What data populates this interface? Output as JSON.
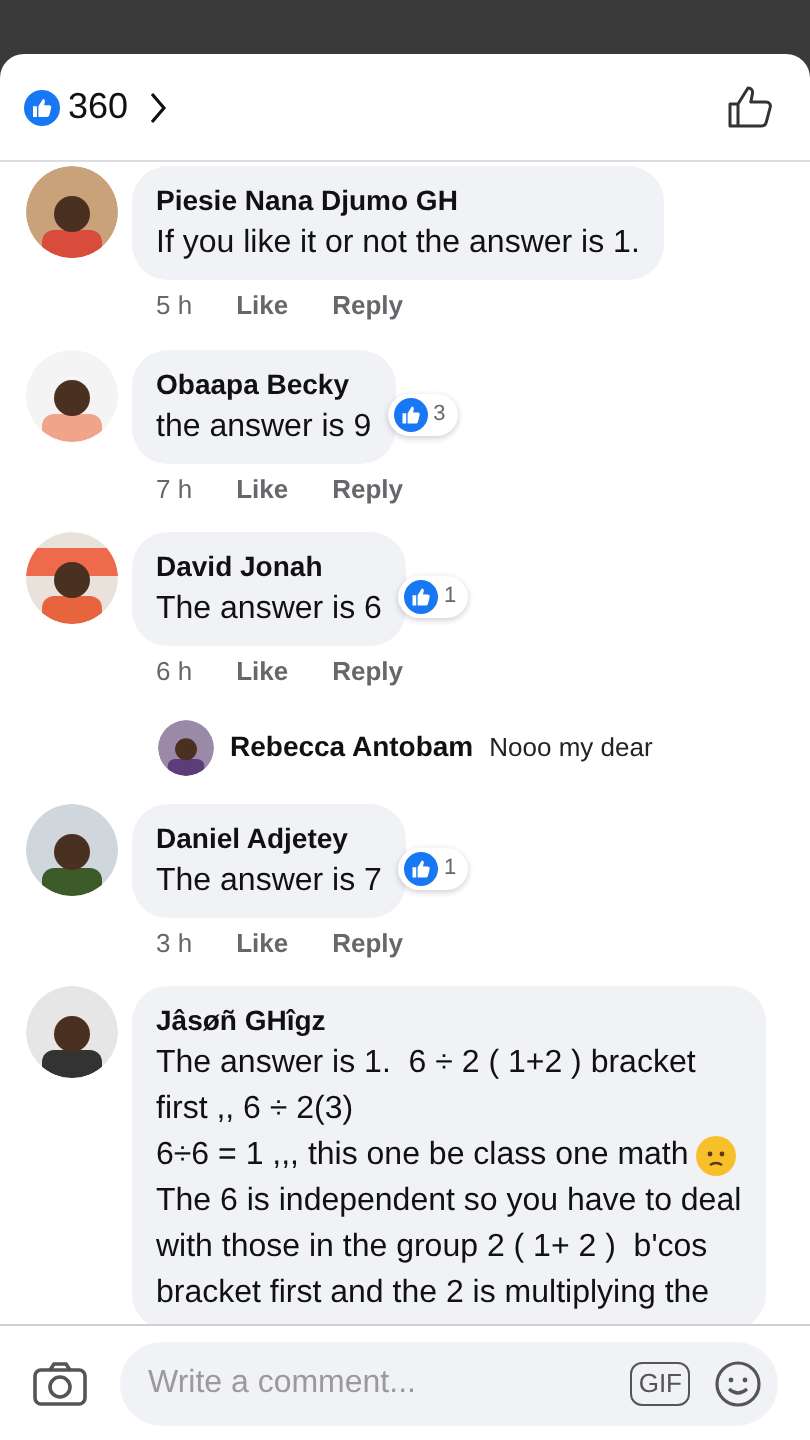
{
  "header": {
    "reaction_count": "360"
  },
  "comments": [
    {
      "kind": "comment",
      "name": "Piesie Nana Djumo GH",
      "lines": [
        {
          "text": "If you like it or not the answer is 1.",
          "emoji": false
        }
      ],
      "time": "5 h",
      "like": "Like",
      "reply": "Reply"
    },
    {
      "kind": "comment",
      "name": "Obaapa Becky",
      "lines": [
        {
          "text": "the answer is 9",
          "emoji": false
        }
      ],
      "reactions": "3",
      "time": "7 h",
      "like": "Like",
      "reply": "Reply"
    },
    {
      "kind": "comment",
      "name": "David Jonah",
      "lines": [
        {
          "text": "The answer is 6",
          "emoji": false
        }
      ],
      "reactions": "1",
      "time": "6 h",
      "like": "Like",
      "reply": "Reply"
    },
    {
      "kind": "reply",
      "name": "Rebecca Antobam",
      "text": "Nooo my dear"
    },
    {
      "kind": "comment",
      "name": "Daniel Adjetey",
      "lines": [
        {
          "text": "The answer is 7",
          "emoji": false
        }
      ],
      "reactions": "1",
      "time": "3 h",
      "like": "Like",
      "reply": "Reply"
    },
    {
      "kind": "comment",
      "name": "Jâsøñ GHîgz",
      "lines": [
        {
          "text": "The answer is 1.  6 ÷ 2 ( 1+2 ) bracket",
          "emoji": false
        },
        {
          "text": "first ,, 6 ÷ 2(3)",
          "emoji": false
        },
        {
          "text": "6÷6 = 1 ,,, this one be class one math",
          "emoji": true
        },
        {
          "text": "The 6 is independent so you have to deal",
          "emoji": false
        },
        {
          "text": "with those in the group 2 ( 1+ 2 )  b'cos",
          "emoji": false
        },
        {
          "text": "bracket first and the 2 is multiplying the",
          "emoji": false
        }
      ]
    }
  ],
  "composer": {
    "placeholder": "Write a comment...",
    "gif": "GIF"
  }
}
